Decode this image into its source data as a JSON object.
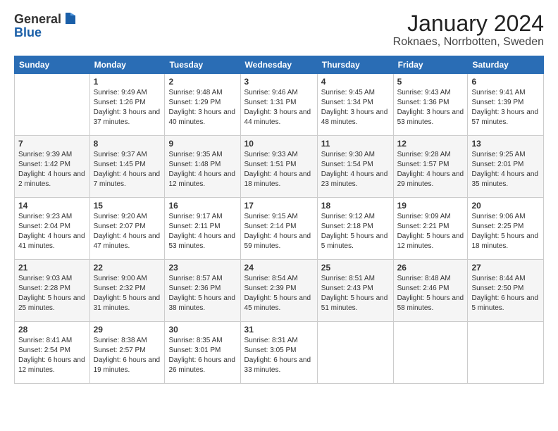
{
  "header": {
    "logo_line1": "General",
    "logo_line2": "Blue",
    "month": "January 2024",
    "location": "Roknaes, Norrbotten, Sweden"
  },
  "weekdays": [
    "Sunday",
    "Monday",
    "Tuesday",
    "Wednesday",
    "Thursday",
    "Friday",
    "Saturday"
  ],
  "weeks": [
    [
      {
        "day": "",
        "sunrise": "",
        "sunset": "",
        "daylight": ""
      },
      {
        "day": "1",
        "sunrise": "Sunrise: 9:49 AM",
        "sunset": "Sunset: 1:26 PM",
        "daylight": "Daylight: 3 hours and 37 minutes."
      },
      {
        "day": "2",
        "sunrise": "Sunrise: 9:48 AM",
        "sunset": "Sunset: 1:29 PM",
        "daylight": "Daylight: 3 hours and 40 minutes."
      },
      {
        "day": "3",
        "sunrise": "Sunrise: 9:46 AM",
        "sunset": "Sunset: 1:31 PM",
        "daylight": "Daylight: 3 hours and 44 minutes."
      },
      {
        "day": "4",
        "sunrise": "Sunrise: 9:45 AM",
        "sunset": "Sunset: 1:34 PM",
        "daylight": "Daylight: 3 hours and 48 minutes."
      },
      {
        "day": "5",
        "sunrise": "Sunrise: 9:43 AM",
        "sunset": "Sunset: 1:36 PM",
        "daylight": "Daylight: 3 hours and 53 minutes."
      },
      {
        "day": "6",
        "sunrise": "Sunrise: 9:41 AM",
        "sunset": "Sunset: 1:39 PM",
        "daylight": "Daylight: 3 hours and 57 minutes."
      }
    ],
    [
      {
        "day": "7",
        "sunrise": "Sunrise: 9:39 AM",
        "sunset": "Sunset: 1:42 PM",
        "daylight": "Daylight: 4 hours and 2 minutes."
      },
      {
        "day": "8",
        "sunrise": "Sunrise: 9:37 AM",
        "sunset": "Sunset: 1:45 PM",
        "daylight": "Daylight: 4 hours and 7 minutes."
      },
      {
        "day": "9",
        "sunrise": "Sunrise: 9:35 AM",
        "sunset": "Sunset: 1:48 PM",
        "daylight": "Daylight: 4 hours and 12 minutes."
      },
      {
        "day": "10",
        "sunrise": "Sunrise: 9:33 AM",
        "sunset": "Sunset: 1:51 PM",
        "daylight": "Daylight: 4 hours and 18 minutes."
      },
      {
        "day": "11",
        "sunrise": "Sunrise: 9:30 AM",
        "sunset": "Sunset: 1:54 PM",
        "daylight": "Daylight: 4 hours and 23 minutes."
      },
      {
        "day": "12",
        "sunrise": "Sunrise: 9:28 AM",
        "sunset": "Sunset: 1:57 PM",
        "daylight": "Daylight: 4 hours and 29 minutes."
      },
      {
        "day": "13",
        "sunrise": "Sunrise: 9:25 AM",
        "sunset": "Sunset: 2:01 PM",
        "daylight": "Daylight: 4 hours and 35 minutes."
      }
    ],
    [
      {
        "day": "14",
        "sunrise": "Sunrise: 9:23 AM",
        "sunset": "Sunset: 2:04 PM",
        "daylight": "Daylight: 4 hours and 41 minutes."
      },
      {
        "day": "15",
        "sunrise": "Sunrise: 9:20 AM",
        "sunset": "Sunset: 2:07 PM",
        "daylight": "Daylight: 4 hours and 47 minutes."
      },
      {
        "day": "16",
        "sunrise": "Sunrise: 9:17 AM",
        "sunset": "Sunset: 2:11 PM",
        "daylight": "Daylight: 4 hours and 53 minutes."
      },
      {
        "day": "17",
        "sunrise": "Sunrise: 9:15 AM",
        "sunset": "Sunset: 2:14 PM",
        "daylight": "Daylight: 4 hours and 59 minutes."
      },
      {
        "day": "18",
        "sunrise": "Sunrise: 9:12 AM",
        "sunset": "Sunset: 2:18 PM",
        "daylight": "Daylight: 5 hours and 5 minutes."
      },
      {
        "day": "19",
        "sunrise": "Sunrise: 9:09 AM",
        "sunset": "Sunset: 2:21 PM",
        "daylight": "Daylight: 5 hours and 12 minutes."
      },
      {
        "day": "20",
        "sunrise": "Sunrise: 9:06 AM",
        "sunset": "Sunset: 2:25 PM",
        "daylight": "Daylight: 5 hours and 18 minutes."
      }
    ],
    [
      {
        "day": "21",
        "sunrise": "Sunrise: 9:03 AM",
        "sunset": "Sunset: 2:28 PM",
        "daylight": "Daylight: 5 hours and 25 minutes."
      },
      {
        "day": "22",
        "sunrise": "Sunrise: 9:00 AM",
        "sunset": "Sunset: 2:32 PM",
        "daylight": "Daylight: 5 hours and 31 minutes."
      },
      {
        "day": "23",
        "sunrise": "Sunrise: 8:57 AM",
        "sunset": "Sunset: 2:36 PM",
        "daylight": "Daylight: 5 hours and 38 minutes."
      },
      {
        "day": "24",
        "sunrise": "Sunrise: 8:54 AM",
        "sunset": "Sunset: 2:39 PM",
        "daylight": "Daylight: 5 hours and 45 minutes."
      },
      {
        "day": "25",
        "sunrise": "Sunrise: 8:51 AM",
        "sunset": "Sunset: 2:43 PM",
        "daylight": "Daylight: 5 hours and 51 minutes."
      },
      {
        "day": "26",
        "sunrise": "Sunrise: 8:48 AM",
        "sunset": "Sunset: 2:46 PM",
        "daylight": "Daylight: 5 hours and 58 minutes."
      },
      {
        "day": "27",
        "sunrise": "Sunrise: 8:44 AM",
        "sunset": "Sunset: 2:50 PM",
        "daylight": "Daylight: 6 hours and 5 minutes."
      }
    ],
    [
      {
        "day": "28",
        "sunrise": "Sunrise: 8:41 AM",
        "sunset": "Sunset: 2:54 PM",
        "daylight": "Daylight: 6 hours and 12 minutes."
      },
      {
        "day": "29",
        "sunrise": "Sunrise: 8:38 AM",
        "sunset": "Sunset: 2:57 PM",
        "daylight": "Daylight: 6 hours and 19 minutes."
      },
      {
        "day": "30",
        "sunrise": "Sunrise: 8:35 AM",
        "sunset": "Sunset: 3:01 PM",
        "daylight": "Daylight: 6 hours and 26 minutes."
      },
      {
        "day": "31",
        "sunrise": "Sunrise: 8:31 AM",
        "sunset": "Sunset: 3:05 PM",
        "daylight": "Daylight: 6 hours and 33 minutes."
      },
      {
        "day": "",
        "sunrise": "",
        "sunset": "",
        "daylight": ""
      },
      {
        "day": "",
        "sunrise": "",
        "sunset": "",
        "daylight": ""
      },
      {
        "day": "",
        "sunrise": "",
        "sunset": "",
        "daylight": ""
      }
    ]
  ]
}
